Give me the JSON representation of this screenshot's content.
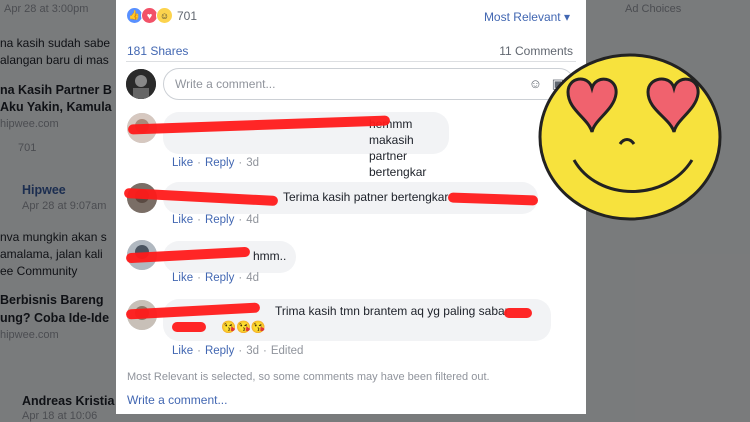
{
  "background": {
    "fragments": [
      "Apr 28 at 3:00pm",
      "na kasih sudah sabe",
      "alangan baru di mas",
      "na Kasih Partner B",
      "Aku Yakin, Kamula",
      "hipwee.com",
      "701",
      "Hipwee",
      "Apr 28 at 9:07am",
      "nva mungkin akan s",
      "amalama, jalan kali",
      "ee Community",
      "Berbisnis Bareng",
      "ung? Coba Ide-Ide",
      "hipwee.com",
      "Andreas Kristia",
      "Apr 18 at 10:06",
      "Ad Choices"
    ]
  },
  "reactions": {
    "icons": [
      "like-icon",
      "love-icon",
      "haha-icon"
    ],
    "count": "701",
    "sort_label": "Most Relevant ▾"
  },
  "stats": {
    "shares": "181 Shares",
    "comments": "11 Comments"
  },
  "composer": {
    "placeholder": "Write a comment..."
  },
  "comments": [
    {
      "text": "hemmm makasih partner bertengkar",
      "actions": [
        "Like",
        "Reply"
      ],
      "time": "3d",
      "edited": ""
    },
    {
      "text": "Terima kasih patner bertengkar",
      "actions": [
        "Like",
        "Reply"
      ],
      "time": "4d",
      "edited": ""
    },
    {
      "text": "hmm..",
      "actions": [
        "Like",
        "Reply"
      ],
      "time": "4d",
      "edited": ""
    },
    {
      "text": "Trima kasih tmn brantem aq yg paling sabar",
      "emoji": "😘😘😘",
      "actions": [
        "Like",
        "Reply"
      ],
      "time": "3d",
      "edited": "Edited"
    }
  ],
  "footer": {
    "notice": "Most Relevant is selected, so some comments may have been filtered out.",
    "write": "Write a comment..."
  },
  "colors": {
    "link": "#4267b2",
    "scribble": "#ff1a1a",
    "emoji_face": "#f7e23d",
    "hearts": "#f0626e"
  }
}
